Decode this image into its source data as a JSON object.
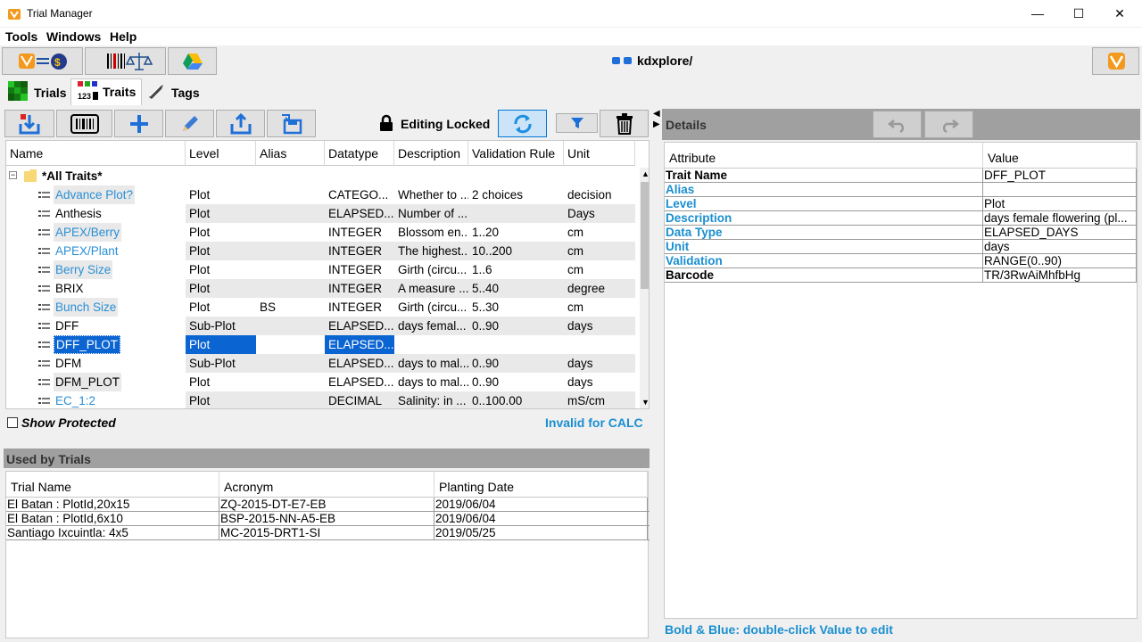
{
  "window": {
    "title": "Trial Manager",
    "minimize": "—",
    "maximize": "☐",
    "close": "✕"
  },
  "menu": [
    "Tools",
    "Windows",
    "Help"
  ],
  "path_label": "kdxplore/",
  "tabs": [
    {
      "label": "Trials",
      "icon": "trials-grid-icon"
    },
    {
      "label": "Traits",
      "icon": "traits-icon"
    },
    {
      "label": "Tags",
      "icon": "tag-icon"
    }
  ],
  "trait_toolbar": {
    "editing_label": "Editing Locked"
  },
  "traits_table": {
    "columns": [
      "Name",
      "Level",
      "Alias",
      "Datatype",
      "Description",
      "Validation Rule",
      "Unit"
    ],
    "group": "*All Traits*",
    "rows": [
      {
        "name": "Advance Plot?",
        "level": "Plot",
        "alias": "",
        "datatype": "CATEGO...",
        "description": "Whether to ...",
        "rule": "2 choices",
        "unit": "decision",
        "blue": true
      },
      {
        "name": "Anthesis",
        "level": "Plot",
        "alias": "",
        "datatype": "ELAPSED...",
        "description": "Number of ...",
        "rule": "",
        "unit": "Days",
        "blue": false
      },
      {
        "name": "APEX/Berry",
        "level": "Plot",
        "alias": "",
        "datatype": "INTEGER",
        "description": "Blossom en...",
        "rule": "1..20",
        "unit": "cm",
        "blue": true
      },
      {
        "name": "APEX/Plant",
        "level": "Plot",
        "alias": "",
        "datatype": "INTEGER",
        "description": "The highest...",
        "rule": "10..200",
        "unit": "cm",
        "blue": true
      },
      {
        "name": "Berry Size",
        "level": "Plot",
        "alias": "",
        "datatype": "INTEGER",
        "description": "Girth (circu...",
        "rule": "1..6",
        "unit": "cm",
        "blue": true
      },
      {
        "name": "BRIX",
        "level": "Plot",
        "alias": "",
        "datatype": "INTEGER",
        "description": "A measure ...",
        "rule": "5..40",
        "unit": "degree",
        "blue": false
      },
      {
        "name": "Bunch Size",
        "level": "Plot",
        "alias": "BS",
        "datatype": "INTEGER",
        "description": "Girth (circu...",
        "rule": "5..30",
        "unit": "cm",
        "blue": true
      },
      {
        "name": "DFF",
        "level": "Sub-Plot",
        "alias": "",
        "datatype": "ELAPSED...",
        "description": "days femal...",
        "rule": "0..90",
        "unit": "days",
        "blue": false
      },
      {
        "name": "DFF_PLOT",
        "level": "Plot",
        "alias": "",
        "datatype": "ELAPSED...",
        "description": "",
        "rule": "",
        "unit": "",
        "blue": false,
        "selected": true
      },
      {
        "name": "DFM",
        "level": "Sub-Plot",
        "alias": "",
        "datatype": "ELAPSED...",
        "description": "days to mal...",
        "rule": "0..90",
        "unit": "days",
        "blue": false
      },
      {
        "name": "DFM_PLOT",
        "level": "Plot",
        "alias": "",
        "datatype": "ELAPSED...",
        "description": "days to mal...",
        "rule": "0..90",
        "unit": "days",
        "blue": false
      },
      {
        "name": "EC_1:2",
        "level": "Plot",
        "alias": "",
        "datatype": "DECIMAL",
        "description": "Salinity: in ...",
        "rule": "0..100.00",
        "unit": "mS/cm",
        "blue": true
      }
    ]
  },
  "show_protected_label": "Show Protected",
  "invalid_label": "Invalid for CALC",
  "used_by": {
    "title": "Used by Trials",
    "columns": [
      "Trial Name",
      "Acronym",
      "Planting Date"
    ],
    "rows": [
      [
        "El Batan : PlotId,20x15",
        "ZQ-2015-DT-E7-EB",
        "2019/06/04"
      ],
      [
        "El Batan : PlotId,6x10",
        "BSP-2015-NN-A5-EB",
        "2019/06/04"
      ],
      [
        "Santiago Ixcuintla: 4x5",
        "MC-2015-DRT1-SI",
        "2019/05/25"
      ]
    ]
  },
  "details": {
    "title": "Details",
    "columns": [
      "Attribute",
      "Value"
    ],
    "rows": [
      {
        "attr": "Trait Name",
        "value": "DFF_PLOT",
        "style": "bold"
      },
      {
        "attr": "Alias",
        "value": "",
        "style": "bluebold"
      },
      {
        "attr": "Level",
        "value": "Plot",
        "style": "bluebold"
      },
      {
        "attr": "Description",
        "value": "days female flowering (pl...",
        "style": "bluebold"
      },
      {
        "attr": "Data Type",
        "value": "ELAPSED_DAYS",
        "style": "bluebold"
      },
      {
        "attr": "Unit",
        "value": "days",
        "style": "bluebold"
      },
      {
        "attr": "Validation",
        "value": "RANGE(0..90)",
        "style": "bluebold"
      },
      {
        "attr": "Barcode",
        "value": "TR/3RwAiMhfbHg",
        "style": "bold"
      }
    ],
    "hint": "Bold & Blue: double-click Value to edit"
  }
}
